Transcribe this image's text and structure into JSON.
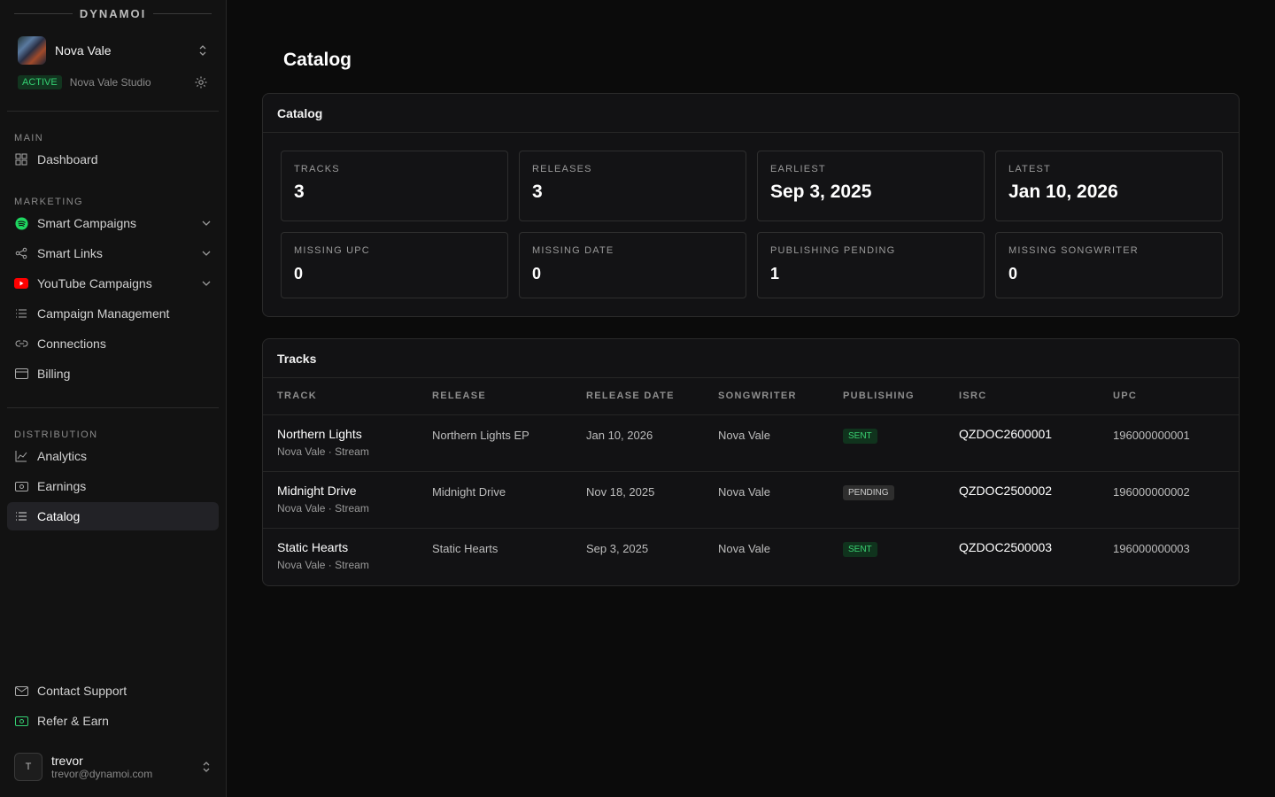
{
  "brand": "DYNAMOI",
  "artist": {
    "name": "Nova Vale",
    "status": "ACTIVE",
    "studio": "Nova Vale Studio"
  },
  "sidebar": {
    "sections": [
      {
        "label": "MAIN",
        "items": [
          {
            "label": "Dashboard",
            "icon": "grid-icon"
          }
        ]
      },
      {
        "label": "MARKETING",
        "items": [
          {
            "label": "Smart Campaigns",
            "icon": "spotify-icon",
            "expandable": true
          },
          {
            "label": "Smart Links",
            "icon": "share-icon",
            "expandable": true
          },
          {
            "label": "YouTube Campaigns",
            "icon": "youtube-icon",
            "expandable": true
          },
          {
            "label": "Campaign Management",
            "icon": "list-icon"
          },
          {
            "label": "Connections",
            "icon": "link-icon"
          },
          {
            "label": "Billing",
            "icon": "card-icon"
          }
        ]
      },
      {
        "label": "DISTRIBUTION",
        "items": [
          {
            "label": "Analytics",
            "icon": "chart-icon"
          },
          {
            "label": "Earnings",
            "icon": "cash-icon"
          },
          {
            "label": "Catalog",
            "icon": "list-icon",
            "active": true
          }
        ]
      }
    ],
    "footer": [
      {
        "label": "Contact Support",
        "icon": "mail-icon"
      },
      {
        "label": "Refer & Earn",
        "icon": "cash-green-icon"
      }
    ],
    "user": {
      "initial": "T",
      "name": "trevor",
      "email": "trevor@dynamoi.com"
    }
  },
  "page": {
    "title": "Catalog"
  },
  "catalog_card": {
    "title": "Catalog",
    "stats": [
      {
        "label": "TRACKS",
        "value": "3"
      },
      {
        "label": "RELEASES",
        "value": "3"
      },
      {
        "label": "EARLIEST",
        "value": "Sep 3, 2025"
      },
      {
        "label": "LATEST",
        "value": "Jan 10, 2026"
      },
      {
        "label": "MISSING UPC",
        "value": "0"
      },
      {
        "label": "MISSING DATE",
        "value": "0"
      },
      {
        "label": "PUBLISHING PENDING",
        "value": "1"
      },
      {
        "label": "MISSING SONGWRITER",
        "value": "0"
      }
    ]
  },
  "tracks_card": {
    "title": "Tracks",
    "columns": [
      "TRACK",
      "RELEASE",
      "RELEASE DATE",
      "SONGWRITER",
      "PUBLISHING",
      "ISRC",
      "UPC"
    ],
    "rows": [
      {
        "track": "Northern Lights",
        "sub": "Nova Vale · Stream",
        "release": "Northern Lights EP",
        "date": "Jan 10, 2026",
        "songwriter": "Nova Vale",
        "publishing": "SENT",
        "isrc": "QZDOC2600001",
        "upc": "196000000001"
      },
      {
        "track": "Midnight Drive",
        "sub": "Nova Vale · Stream",
        "release": "Midnight Drive",
        "date": "Nov 18, 2025",
        "songwriter": "Nova Vale",
        "publishing": "PENDING",
        "isrc": "QZDOC2500002",
        "upc": "196000000002"
      },
      {
        "track": "Static Hearts",
        "sub": "Nova Vale · Stream",
        "release": "Static Hearts",
        "date": "Sep 3, 2025",
        "songwriter": "Nova Vale",
        "publishing": "SENT",
        "isrc": "QZDOC2500003",
        "upc": "196000000003"
      }
    ]
  },
  "colors": {
    "accent_green": "#34d072",
    "background": "#0b0b0b",
    "sidebar": "#121212"
  }
}
